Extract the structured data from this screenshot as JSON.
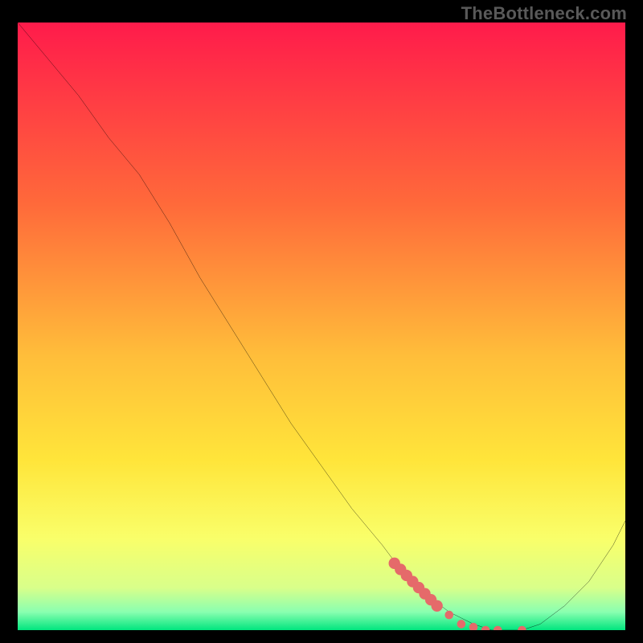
{
  "watermark": "TheBottleneck.com",
  "chart_data": {
    "type": "line",
    "title": "",
    "xlabel": "",
    "ylabel": "",
    "xlim": [
      0,
      100
    ],
    "ylim": [
      0,
      100
    ],
    "grid": false,
    "legend": false,
    "background_gradient": {
      "top": "#ff1b4b",
      "mid_upper": "#ffa43a",
      "mid": "#ffe53a",
      "mid_lower": "#f7ff7a",
      "bottom": "#00e57e"
    },
    "series": [
      {
        "name": "curve",
        "color": "#000000",
        "stroke_width": 2,
        "x": [
          0,
          5,
          10,
          15,
          20,
          25,
          30,
          35,
          40,
          45,
          50,
          55,
          60,
          63,
          67,
          71,
          75,
          78,
          80,
          83,
          86,
          90,
          94,
          98,
          100
        ],
        "y": [
          100,
          94,
          88,
          81,
          75,
          67,
          58,
          50,
          42,
          34,
          27,
          20,
          14,
          10,
          6,
          3,
          1,
          0,
          0,
          0,
          1,
          4,
          8,
          14,
          18
        ]
      }
    ],
    "highlight_points": {
      "name": "dotted-marker",
      "color": "#e56a6a",
      "radius_main": 5,
      "radius_minor": 3.5,
      "points": [
        {
          "x": 62,
          "y": 11.0
        },
        {
          "x": 63,
          "y": 10.0
        },
        {
          "x": 64,
          "y": 9.0
        },
        {
          "x": 65,
          "y": 8.0
        },
        {
          "x": 66,
          "y": 7.0
        },
        {
          "x": 67,
          "y": 6.0
        },
        {
          "x": 68,
          "y": 5.0
        },
        {
          "x": 69,
          "y": 4.0
        },
        {
          "x": 71,
          "y": 2.5
        },
        {
          "x": 73,
          "y": 1.0
        },
        {
          "x": 75,
          "y": 0.5
        },
        {
          "x": 77,
          "y": 0.0
        },
        {
          "x": 79,
          "y": 0.0
        },
        {
          "x": 83,
          "y": 0.0
        }
      ]
    }
  }
}
